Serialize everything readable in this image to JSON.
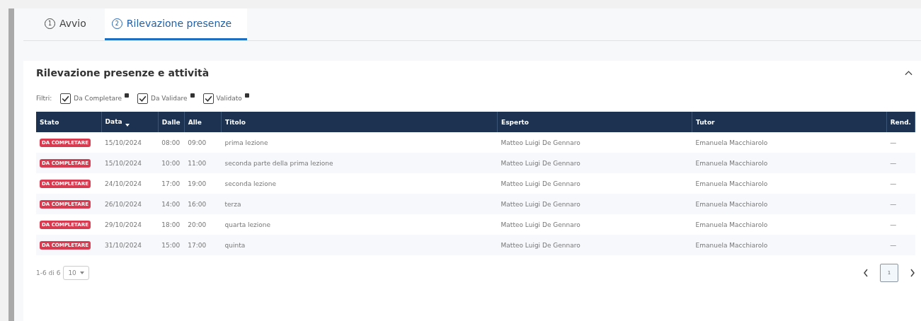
{
  "tabs": [
    {
      "number": "1",
      "label": "Avvio",
      "selected": false
    },
    {
      "number": "2",
      "label": "Rilevazione presenze",
      "selected": true
    }
  ],
  "panel": {
    "title": "Rilevazione presenze e attività",
    "expanded": true,
    "filters": {
      "label": "Filtri:",
      "items": [
        {
          "label": "Da Completare",
          "checked": true
        },
        {
          "label": "Da Validare",
          "checked": true
        },
        {
          "label": "Validato",
          "checked": true
        }
      ]
    },
    "table": {
      "columns": [
        {
          "label": "Stato",
          "sorted": false
        },
        {
          "label": "Data",
          "sorted": true
        },
        {
          "label": "Dalle",
          "sorted": false
        },
        {
          "label": "Alle",
          "sorted": false
        },
        {
          "label": "Titolo",
          "sorted": false
        },
        {
          "label": "Esperto",
          "sorted": false
        },
        {
          "label": "Tutor",
          "sorted": false
        },
        {
          "label": "Rend.",
          "sorted": false
        }
      ],
      "rows": [
        {
          "cells": [
            "DA COMPLETARE",
            "15/10/2024",
            "08:00",
            "09:00",
            "prima lezione",
            "Matteo Luigi De Gennaro",
            "Emanuela Macchiarolo",
            "—"
          ]
        },
        {
          "cells": [
            "DA COMPLETARE",
            "15/10/2024",
            "10:00",
            "11:00",
            "seconda parte della prima lezione",
            "Matteo Luigi De Gennaro",
            "Emanuela Macchiarolo",
            "—"
          ]
        },
        {
          "cells": [
            "DA COMPLETARE",
            "24/10/2024",
            "17:00",
            "19:00",
            "seconda lezione",
            "Matteo Luigi De Gennaro",
            "Emanuela Macchiarolo",
            "—"
          ]
        },
        {
          "cells": [
            "DA COMPLETARE",
            "26/10/2024",
            "14:00",
            "16:00",
            "terza",
            "Matteo Luigi De Gennaro",
            "Emanuela Macchiarolo",
            "—"
          ]
        },
        {
          "cells": [
            "DA COMPLETARE",
            "29/10/2024",
            "18:00",
            "20:00",
            "quarta lezione",
            "Matteo Luigi De Gennaro",
            "Emanuela Macchiarolo",
            "—"
          ]
        },
        {
          "cells": [
            "DA COMPLETARE",
            "31/10/2024",
            "15:00",
            "17:00",
            "quinta",
            "Matteo Luigi De Gennaro",
            "Emanuela Macchiarolo",
            "—"
          ]
        }
      ]
    },
    "pagination": {
      "range": "1-6 di 6",
      "page_size": "10",
      "pages": [
        {
          "label": "1",
          "selected": true
        }
      ]
    }
  }
}
